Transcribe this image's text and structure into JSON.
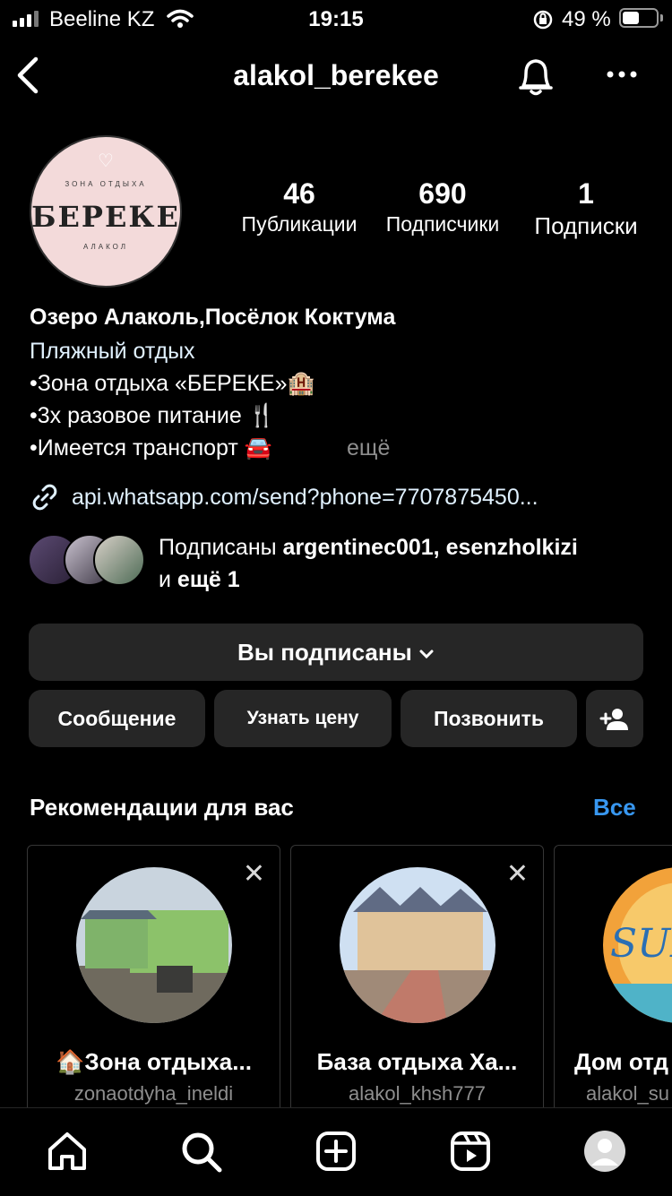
{
  "status_bar": {
    "carrier": "Beeline KZ",
    "time": "19:15",
    "battery_percent": "49 %",
    "battery_level": 0.49
  },
  "header": {
    "username": "alakol_berekee"
  },
  "avatar": {
    "top_text": "ЗОНА ОТДЫХА",
    "logo_text": "БЕРЕКЕ",
    "bottom_text": "АЛАКОЛ"
  },
  "stats": [
    {
      "value": "46",
      "label": "Публикации"
    },
    {
      "value": "690",
      "label": "Подписчики"
    },
    {
      "value": "1",
      "label": "Подписки"
    }
  ],
  "bio": {
    "name": "Озеро Алаколь,Посёлок Коктума",
    "category": "Пляжный отдых",
    "line1": "•Зона отдыха «БЕРЕКЕ»🏨",
    "line2": "•3х разовое питание 🍴",
    "line3": "•Имеется транспорт 🚘",
    "more": "ещё",
    "link": "api.whatsapp.com/send?phone=7707875450..."
  },
  "followed_by": {
    "prefix": "Подписаны ",
    "names": "argentinec001, esenzholkizi",
    "and": "и ",
    "more": "ещё 1"
  },
  "buttons": {
    "following": "Вы подписаны",
    "message": "Сообщение",
    "price": "Узнать цену",
    "call": "Позвонить"
  },
  "recommendations": {
    "title": "Рекомендации для вас",
    "see_all": "Все",
    "cards": [
      {
        "name": "🏠Зона отдыха...",
        "username": "zonaotdyha_ineldi"
      },
      {
        "name": "База отдыха Ха...",
        "username": "alakol_khsh777"
      },
      {
        "name": "Дом отд",
        "username": "alakol_su"
      }
    ]
  },
  "colors": {
    "background": "#000000",
    "button": "#262626",
    "link": "#e0f1ff",
    "accent_blue": "#3897f0",
    "secondary_text": "#8e8e8e"
  },
  "icons": [
    "back-icon",
    "bell-icon",
    "more-icon",
    "link-icon",
    "close-icon",
    "home-icon",
    "search-icon",
    "new-post-icon",
    "reels-icon",
    "profile-icon",
    "add-person-icon",
    "chevron-down-icon"
  ]
}
